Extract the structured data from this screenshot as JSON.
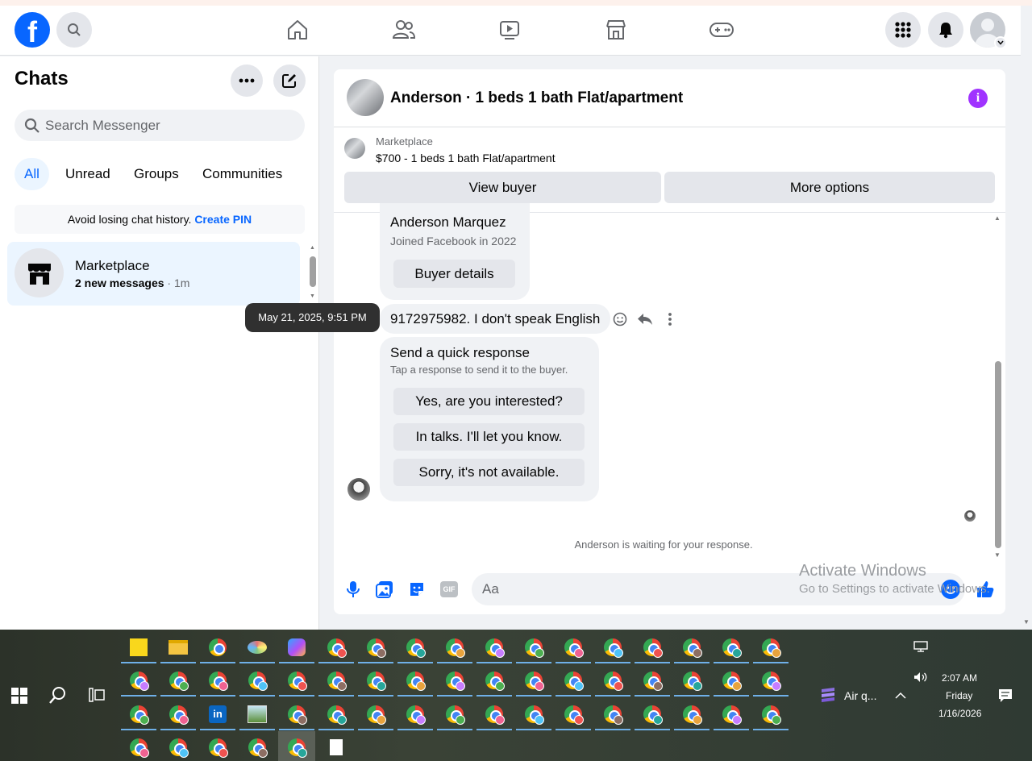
{
  "nav": {
    "logo": "f",
    "icons": [
      "search-icon",
      "home-icon",
      "friends-icon",
      "watch-icon",
      "marketplace-icon",
      "gaming-icon",
      "menu-grid-icon",
      "notifications-icon",
      "account-icon"
    ]
  },
  "chats": {
    "title": "Chats",
    "search_placeholder": "Search Messenger",
    "tabs": [
      {
        "label": "All",
        "active": true
      },
      {
        "label": "Unread"
      },
      {
        "label": "Groups"
      },
      {
        "label": "Communities"
      }
    ],
    "pin_banner": {
      "text": "Avoid losing chat history.",
      "link": "Create PIN"
    },
    "items": [
      {
        "name": "Marketplace",
        "preview": "2 new messages",
        "time": "· 1m"
      }
    ]
  },
  "tooltip": "May 21, 2025, 9:51 PM",
  "conversation": {
    "title": "Anderson · 1 beds 1 bath Flat/apartment",
    "marketplace": {
      "label": "Marketplace",
      "listing": "$700 - 1 beds 1 bath Flat/apartment",
      "view_buyer": "View buyer",
      "more_options": "More options"
    },
    "buyer_card": {
      "name": "Anderson Marquez",
      "joined": "Joined Facebook in 2022",
      "button": "Buyer details"
    },
    "message": "9172975982.  I don't speak English",
    "quick_response": {
      "title": "Send a quick response",
      "subtitle": "Tap a response to send it to the buyer.",
      "options": [
        "Yes, are you interested?",
        "In talks. I'll let you know.",
        "Sorry, it's not available."
      ]
    },
    "waiting": "Anderson is waiting for your response.",
    "composer_placeholder": "Aa",
    "composer_icons": [
      "microphone-icon",
      "photo-icon",
      "sticker-icon",
      "gif-icon",
      "emoji-icon",
      "thumbs-up-icon"
    ],
    "gif_label": "GIF"
  },
  "watermark": {
    "line1": "Activate Windows",
    "line2": "Go to Settings to activate Windows."
  },
  "taskbar": {
    "weather": "Air q...",
    "time": "2:07 AM",
    "day": "Friday",
    "date": "1/16/2026",
    "colors": {
      "underline": "#6fb0e8",
      "accent": "#0866ff"
    }
  }
}
